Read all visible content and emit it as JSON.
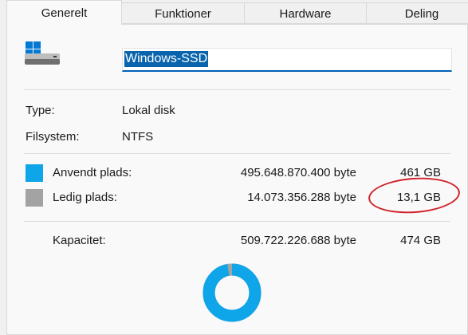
{
  "tabs": [
    {
      "label": "Generelt",
      "active": true
    },
    {
      "label": "Funktioner",
      "active": false
    },
    {
      "label": "Hardware",
      "active": false
    },
    {
      "label": "Deling",
      "active": false
    }
  ],
  "drive": {
    "name": "Windows-SSD",
    "icon": "drive-icon"
  },
  "info": {
    "type_label": "Type:",
    "type_value": "Lokal disk",
    "fs_label": "Filsystem:",
    "fs_value": "NTFS"
  },
  "usage": {
    "used": {
      "label": "Anvendt plads:",
      "bytes": "495.648.870.400 byte",
      "size": "461 GB",
      "color": "#0ea5e9"
    },
    "free": {
      "label": "Ledig plads:",
      "bytes": "14.073.356.288 byte",
      "size": "13,1 GB",
      "color": "#a3a3a3"
    },
    "capacity": {
      "label": "Kapacitet:",
      "bytes": "509.722.226.688 byte",
      "size": "474 GB"
    },
    "used_fraction": 0.9724
  },
  "annotation_color": "#d0202a"
}
